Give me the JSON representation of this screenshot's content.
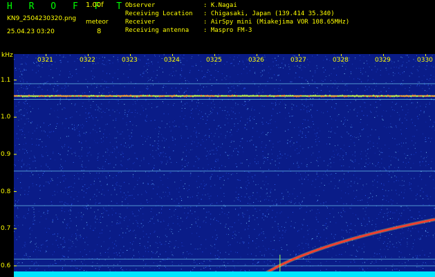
{
  "header": {
    "logo": "H R O F F T",
    "version": "1.00f",
    "filename": "KN9_2504230320.png",
    "datetime": "25.04.23 03:20",
    "meteor_label": "meteor",
    "meteor_count": "8"
  },
  "station": {
    "observer_label": "Observer",
    "observer_value": ": K.Nagai",
    "location_label": "Receiving Location",
    "location_value": ": Chigasaki, Japan (139.414 35.340)",
    "receiver_label": "Receiver",
    "receiver_value": ": AirSpy mini (Miakejima VOR 108.65MHz)",
    "antenna_label": "Receiving antenna",
    "antenna_value": ": Maspro FM-3"
  },
  "spectrogram": {
    "unit_label": "kHz",
    "y_ticks": [
      "1.1",
      "1.0",
      "0.9",
      "0.8",
      "0.7",
      "0.6"
    ],
    "x_ticks": [
      "0321",
      "0322",
      "0323",
      "0324",
      "0325",
      "0326",
      "0327",
      "0328",
      "0329",
      "0330"
    ],
    "ylim": [
      0.57,
      1.17
    ],
    "colors": {
      "background": "#0a1c88",
      "label": "#ffff00",
      "logo": "#00ff00",
      "noise_floor": "#00e5ff"
    },
    "carrier_khz": [
      1.09,
      1.058,
      1.048,
      0.855,
      0.762,
      0.618,
      0.6
    ]
  }
}
